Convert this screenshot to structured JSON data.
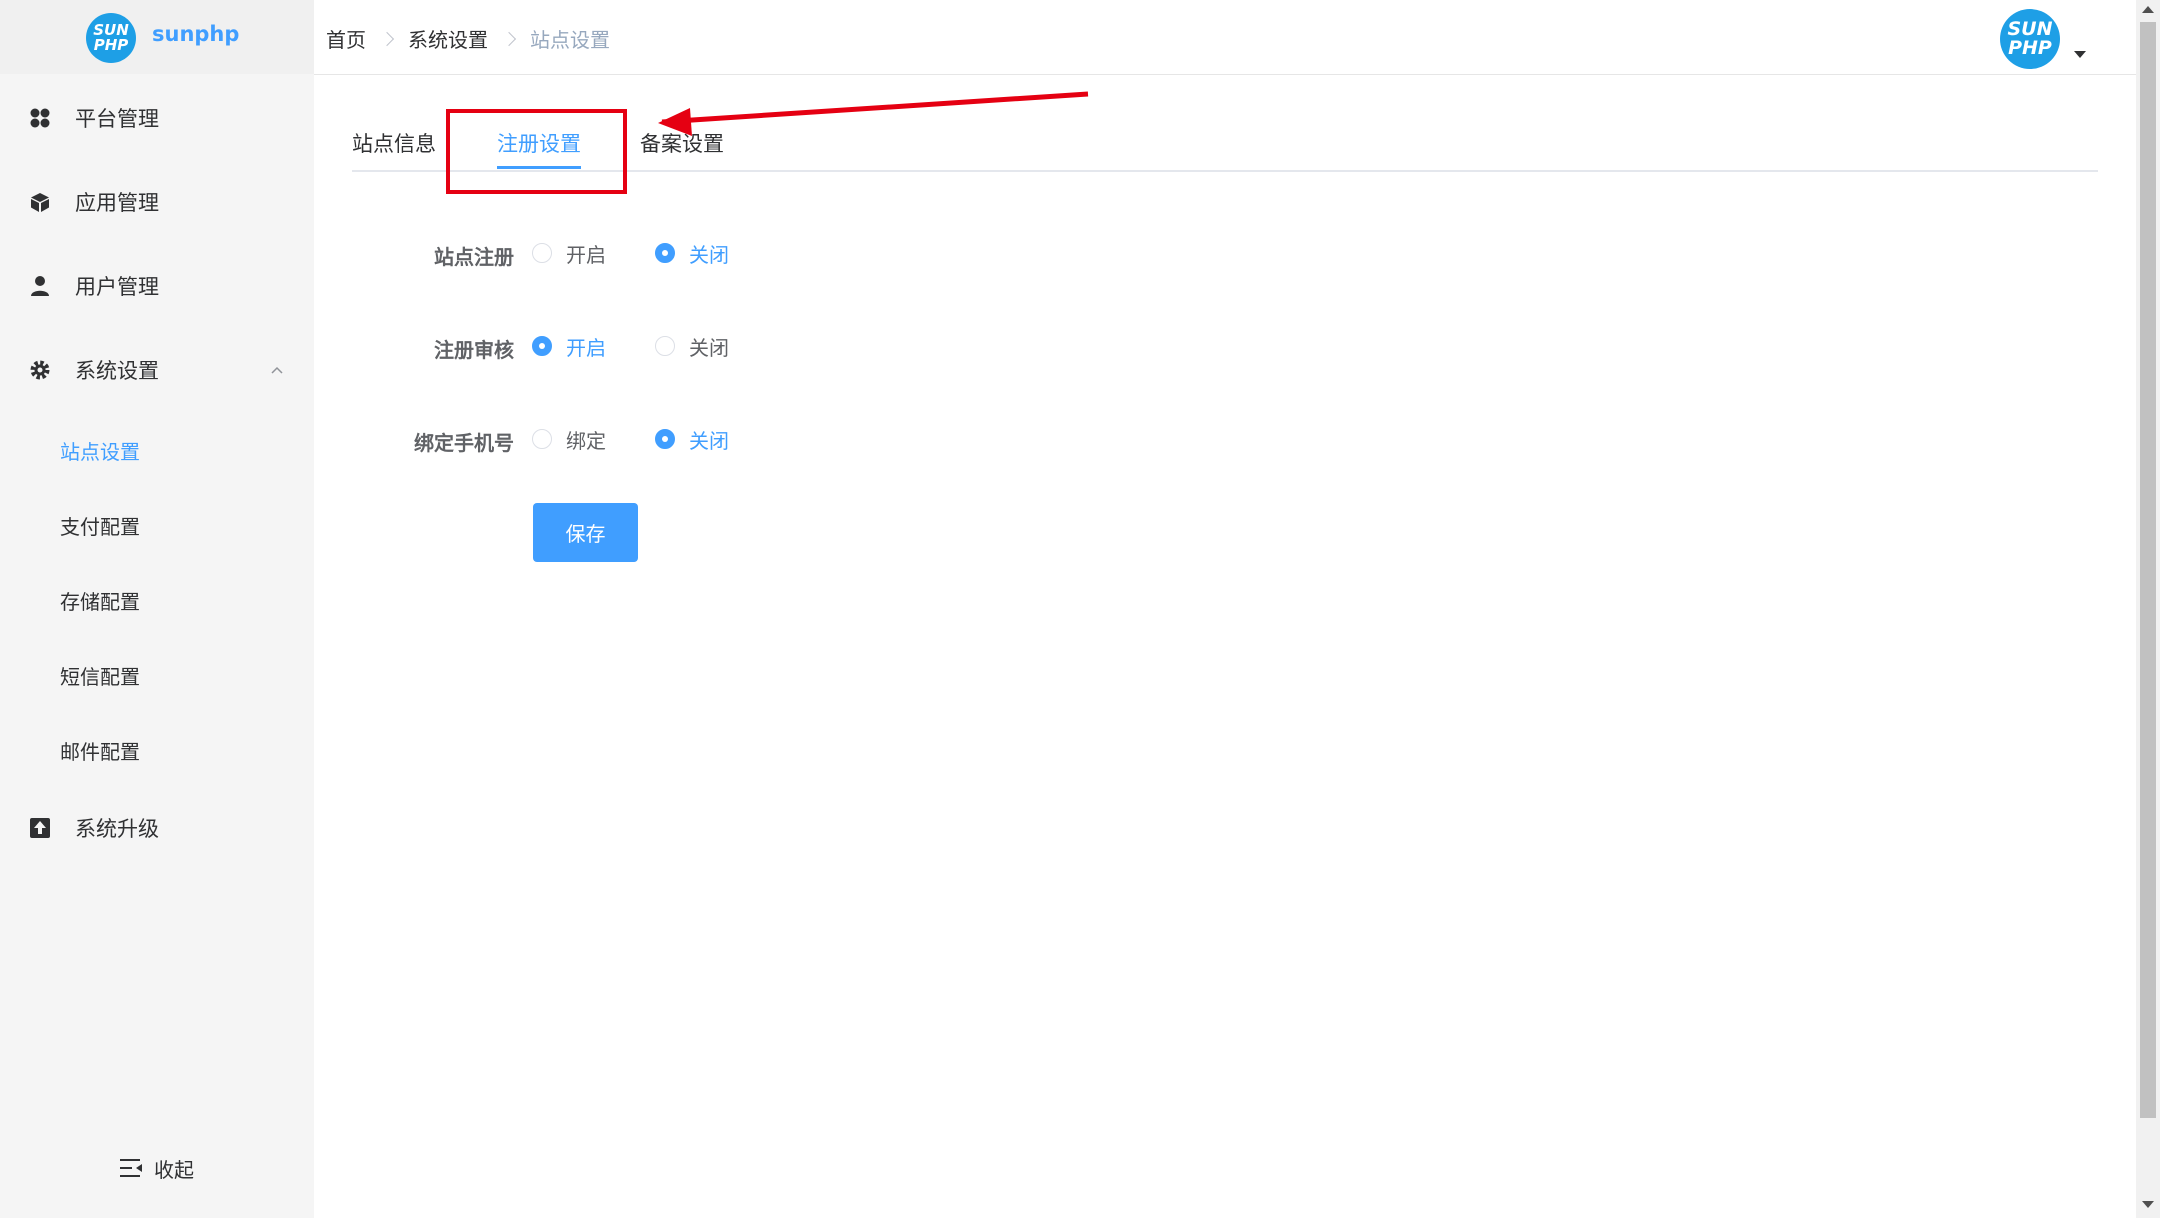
{
  "brand": {
    "logo_text_line1": "SUN",
    "logo_text_line2": "PHP",
    "name": "sunphp"
  },
  "sidebar": {
    "items": [
      {
        "label": "平台管理",
        "icon": "grid-clover-icon"
      },
      {
        "label": "应用管理",
        "icon": "cube-icon"
      },
      {
        "label": "用户管理",
        "icon": "user-icon"
      },
      {
        "label": "系统设置",
        "icon": "gear-icon",
        "expanded": true
      },
      {
        "label": "系统升级",
        "icon": "upload-icon"
      }
    ],
    "submenu": [
      {
        "label": "站点设置",
        "active": true
      },
      {
        "label": "支付配置"
      },
      {
        "label": "存储配置"
      },
      {
        "label": "短信配置"
      },
      {
        "label": "邮件配置"
      }
    ],
    "collapse_label": "收起"
  },
  "header": {
    "breadcrumb": [
      "首页",
      "系统设置",
      "站点设置"
    ],
    "avatar_line1": "SUN",
    "avatar_line2": "PHP"
  },
  "tabs": [
    {
      "label": "站点信息"
    },
    {
      "label": "注册设置",
      "active": true
    },
    {
      "label": "备案设置"
    }
  ],
  "form": {
    "rows": [
      {
        "label": "站点注册",
        "options": [
          "开启",
          "关闭"
        ],
        "selected": "关闭"
      },
      {
        "label": "注册审核",
        "options": [
          "开启",
          "关闭"
        ],
        "selected": "开启"
      },
      {
        "label": "绑定手机号",
        "options": [
          "绑定",
          "关闭"
        ],
        "selected": "关闭"
      }
    ],
    "save_label": "保存"
  },
  "colors": {
    "accent": "#409eff",
    "annotation": "#e50012",
    "sidebar_bg": "#f5f5f5"
  }
}
